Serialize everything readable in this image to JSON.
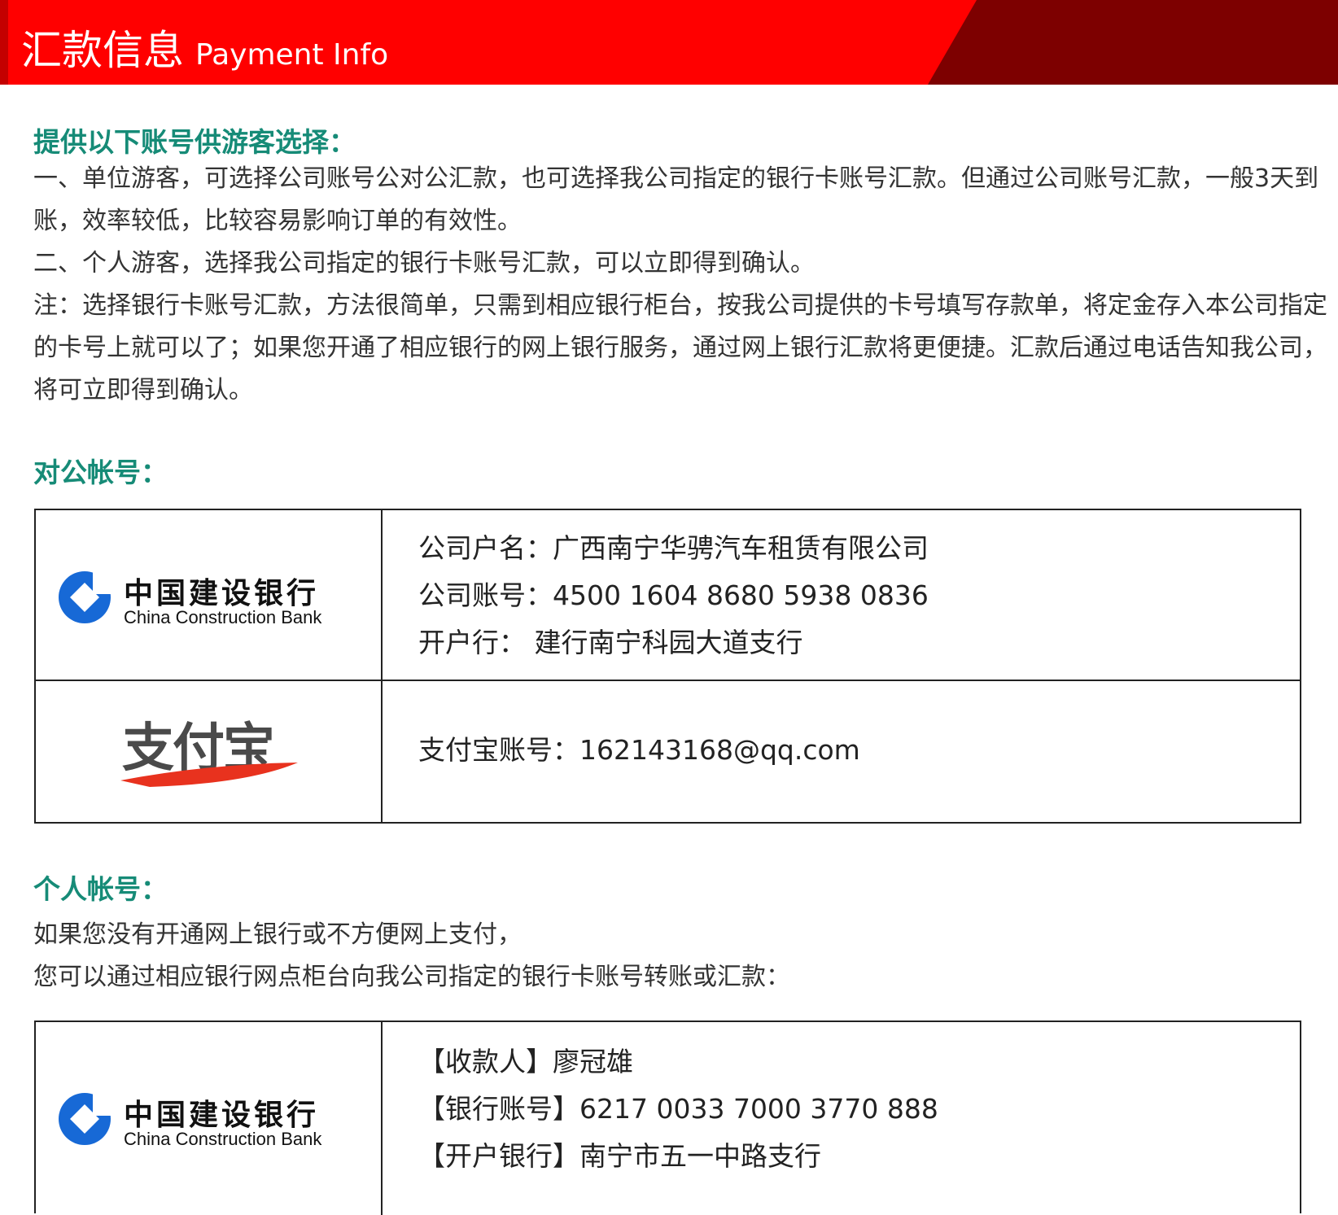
{
  "banner": {
    "title_zh": "汇款信息",
    "title_en": "Payment Info"
  },
  "intro": {
    "heading": "提供以下账号供游客选择：",
    "lines": [
      "一、单位游客，可选择公司账号公对公汇款，也可选择我公司指定的银行卡账号汇款。但通过公司账号汇款，一般3天到",
      "账，效率较低，比较容易影响订单的有效性。",
      "二、个人游客，选择我公司指定的银行卡账号汇款，可以立即得到确认。",
      "注：选择银行卡账号汇款，方法很简单，只需到相应银行柜台，按我公司提供的卡号填写存款单，将定金存入本公司指定",
      "的卡号上就可以了；如果您开通了相应银行的网上银行服务，通过网上银行汇款将更便捷。汇款后通过电话告知我公司，",
      "将可立即得到确认。"
    ]
  },
  "corporate": {
    "heading": "对公帐号：",
    "ccb_logo": {
      "cn": "中国建设银行",
      "en": "China Construction Bank"
    },
    "bank_lines": [
      "公司户名：广西南宁华骋汽车租赁有限公司",
      "公司账号：4500 1604 8680 5938 0836",
      "开户行：  建行南宁科园大道支行"
    ],
    "alipay_logo": "支付宝",
    "alipay_line": "支付宝账号：162143168@qq.com"
  },
  "personal": {
    "heading": "个人帐号：",
    "lines": [
      "如果您没有开通网上银行或不方便网上支付，",
      "您可以通过相应银行网点柜台向我公司指定的银行卡账号转账或汇款："
    ],
    "ccb_logo": {
      "cn": "中国建设银行",
      "en": "China Construction Bank"
    },
    "bank_lines": [
      "【收款人】廖冠雄",
      "【银行账号】6217 0033 7000 3770 888",
      "【开户银行】南宁市五一中路支行"
    ]
  },
  "colors": {
    "banner_red": "#ff0000",
    "banner_dark": "#7d0000",
    "heading_teal": "#168b77",
    "ccb_blue": "#1769d6",
    "alipay_red": "#e8321e"
  }
}
